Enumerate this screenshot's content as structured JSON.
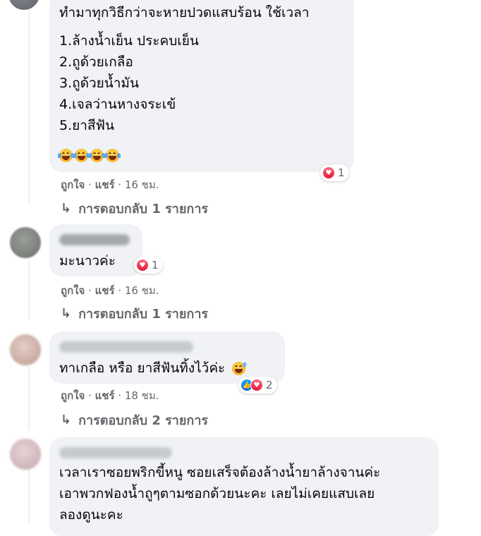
{
  "comments": [
    {
      "name": "",
      "lines": [
        "ทำมาทุกวิธีกว่าจะหายปวดแสบร้อน ใช้เวลา",
        "1.ล้างน้ำเย็น ประคบเย็น",
        "2.ถูด้วยเกลือ",
        "3.ถูด้วยน้ำมัน",
        "4.เจลว่านหางจระเข้",
        "5.ยาสีฟัน"
      ],
      "emoji": [
        "laugh-tears-emoji",
        "laugh-tears-emoji",
        "laugh-tears-emoji",
        "laugh-tears-emoji"
      ],
      "reaction_count": "1",
      "like": "ถูกใจ",
      "share": "แชร์",
      "sep": " · ",
      "time": "16 ชม.",
      "replies": "การตอบกลับ 1 รายการ"
    },
    {
      "name": "",
      "lines": [
        "มะนาวค่ะ"
      ],
      "reaction_count": "1",
      "like": "ถูกใจ",
      "share": "แชร์",
      "sep": " · ",
      "time": "16 ชม.",
      "replies": "การตอบกลับ 1 รายการ"
    },
    {
      "name": "",
      "lines": [
        "ทาเกลือ หรือ ยาสีฟันทิ้งไว้ค่ะ"
      ],
      "emoji": [
        "sweat-smile-emoji"
      ],
      "reaction_count": "2",
      "like": "ถูกใจ",
      "share": "แชร์",
      "sep": " · ",
      "time": "18 ชม.",
      "replies": "การตอบกลับ 2 รายการ"
    },
    {
      "name": "",
      "lines": [
        "เวลาเราซอยพริกขี้หนู ซอยเสร็จต้องล้างน้ำยาล้างจานค่ะ",
        "เอาพวกฟองน้ำถูๆตามซอกด้วยนะคะ เลยไม่เคยแสบเลย",
        "ลองดูนะคะ"
      ]
    }
  ],
  "colors": {
    "bubble": "#f0f2f5",
    "meta": "#65676b",
    "love": "#f33e58",
    "like": "#1877f2"
  }
}
